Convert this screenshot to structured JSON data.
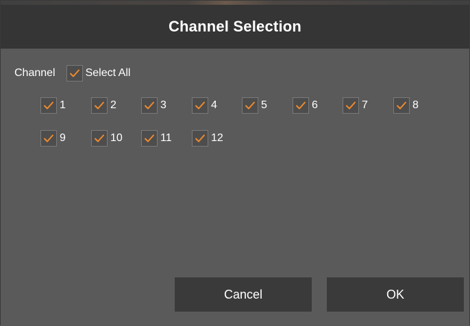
{
  "dialog": {
    "title": "Channel Selection",
    "channel_label": "Channel",
    "select_all_label": "Select All",
    "select_all_checked": true
  },
  "channels": [
    {
      "label": "1",
      "checked": true
    },
    {
      "label": "2",
      "checked": true
    },
    {
      "label": "3",
      "checked": true
    },
    {
      "label": "4",
      "checked": true
    },
    {
      "label": "5",
      "checked": true
    },
    {
      "label": "6",
      "checked": true
    },
    {
      "label": "7",
      "checked": true
    },
    {
      "label": "8",
      "checked": true
    },
    {
      "label": "9",
      "checked": true
    },
    {
      "label": "10",
      "checked": true
    },
    {
      "label": "11",
      "checked": true
    },
    {
      "label": "12",
      "checked": true
    }
  ],
  "buttons": {
    "cancel_label": "Cancel",
    "ok_label": "OK"
  },
  "colors": {
    "check_color": "#ef8a2e",
    "title_bar": "#353535",
    "body_bg": "#5a5a5a",
    "button_bg": "#3a3a3a"
  },
  "icons": {
    "checkbox": "checkmark-icon"
  }
}
